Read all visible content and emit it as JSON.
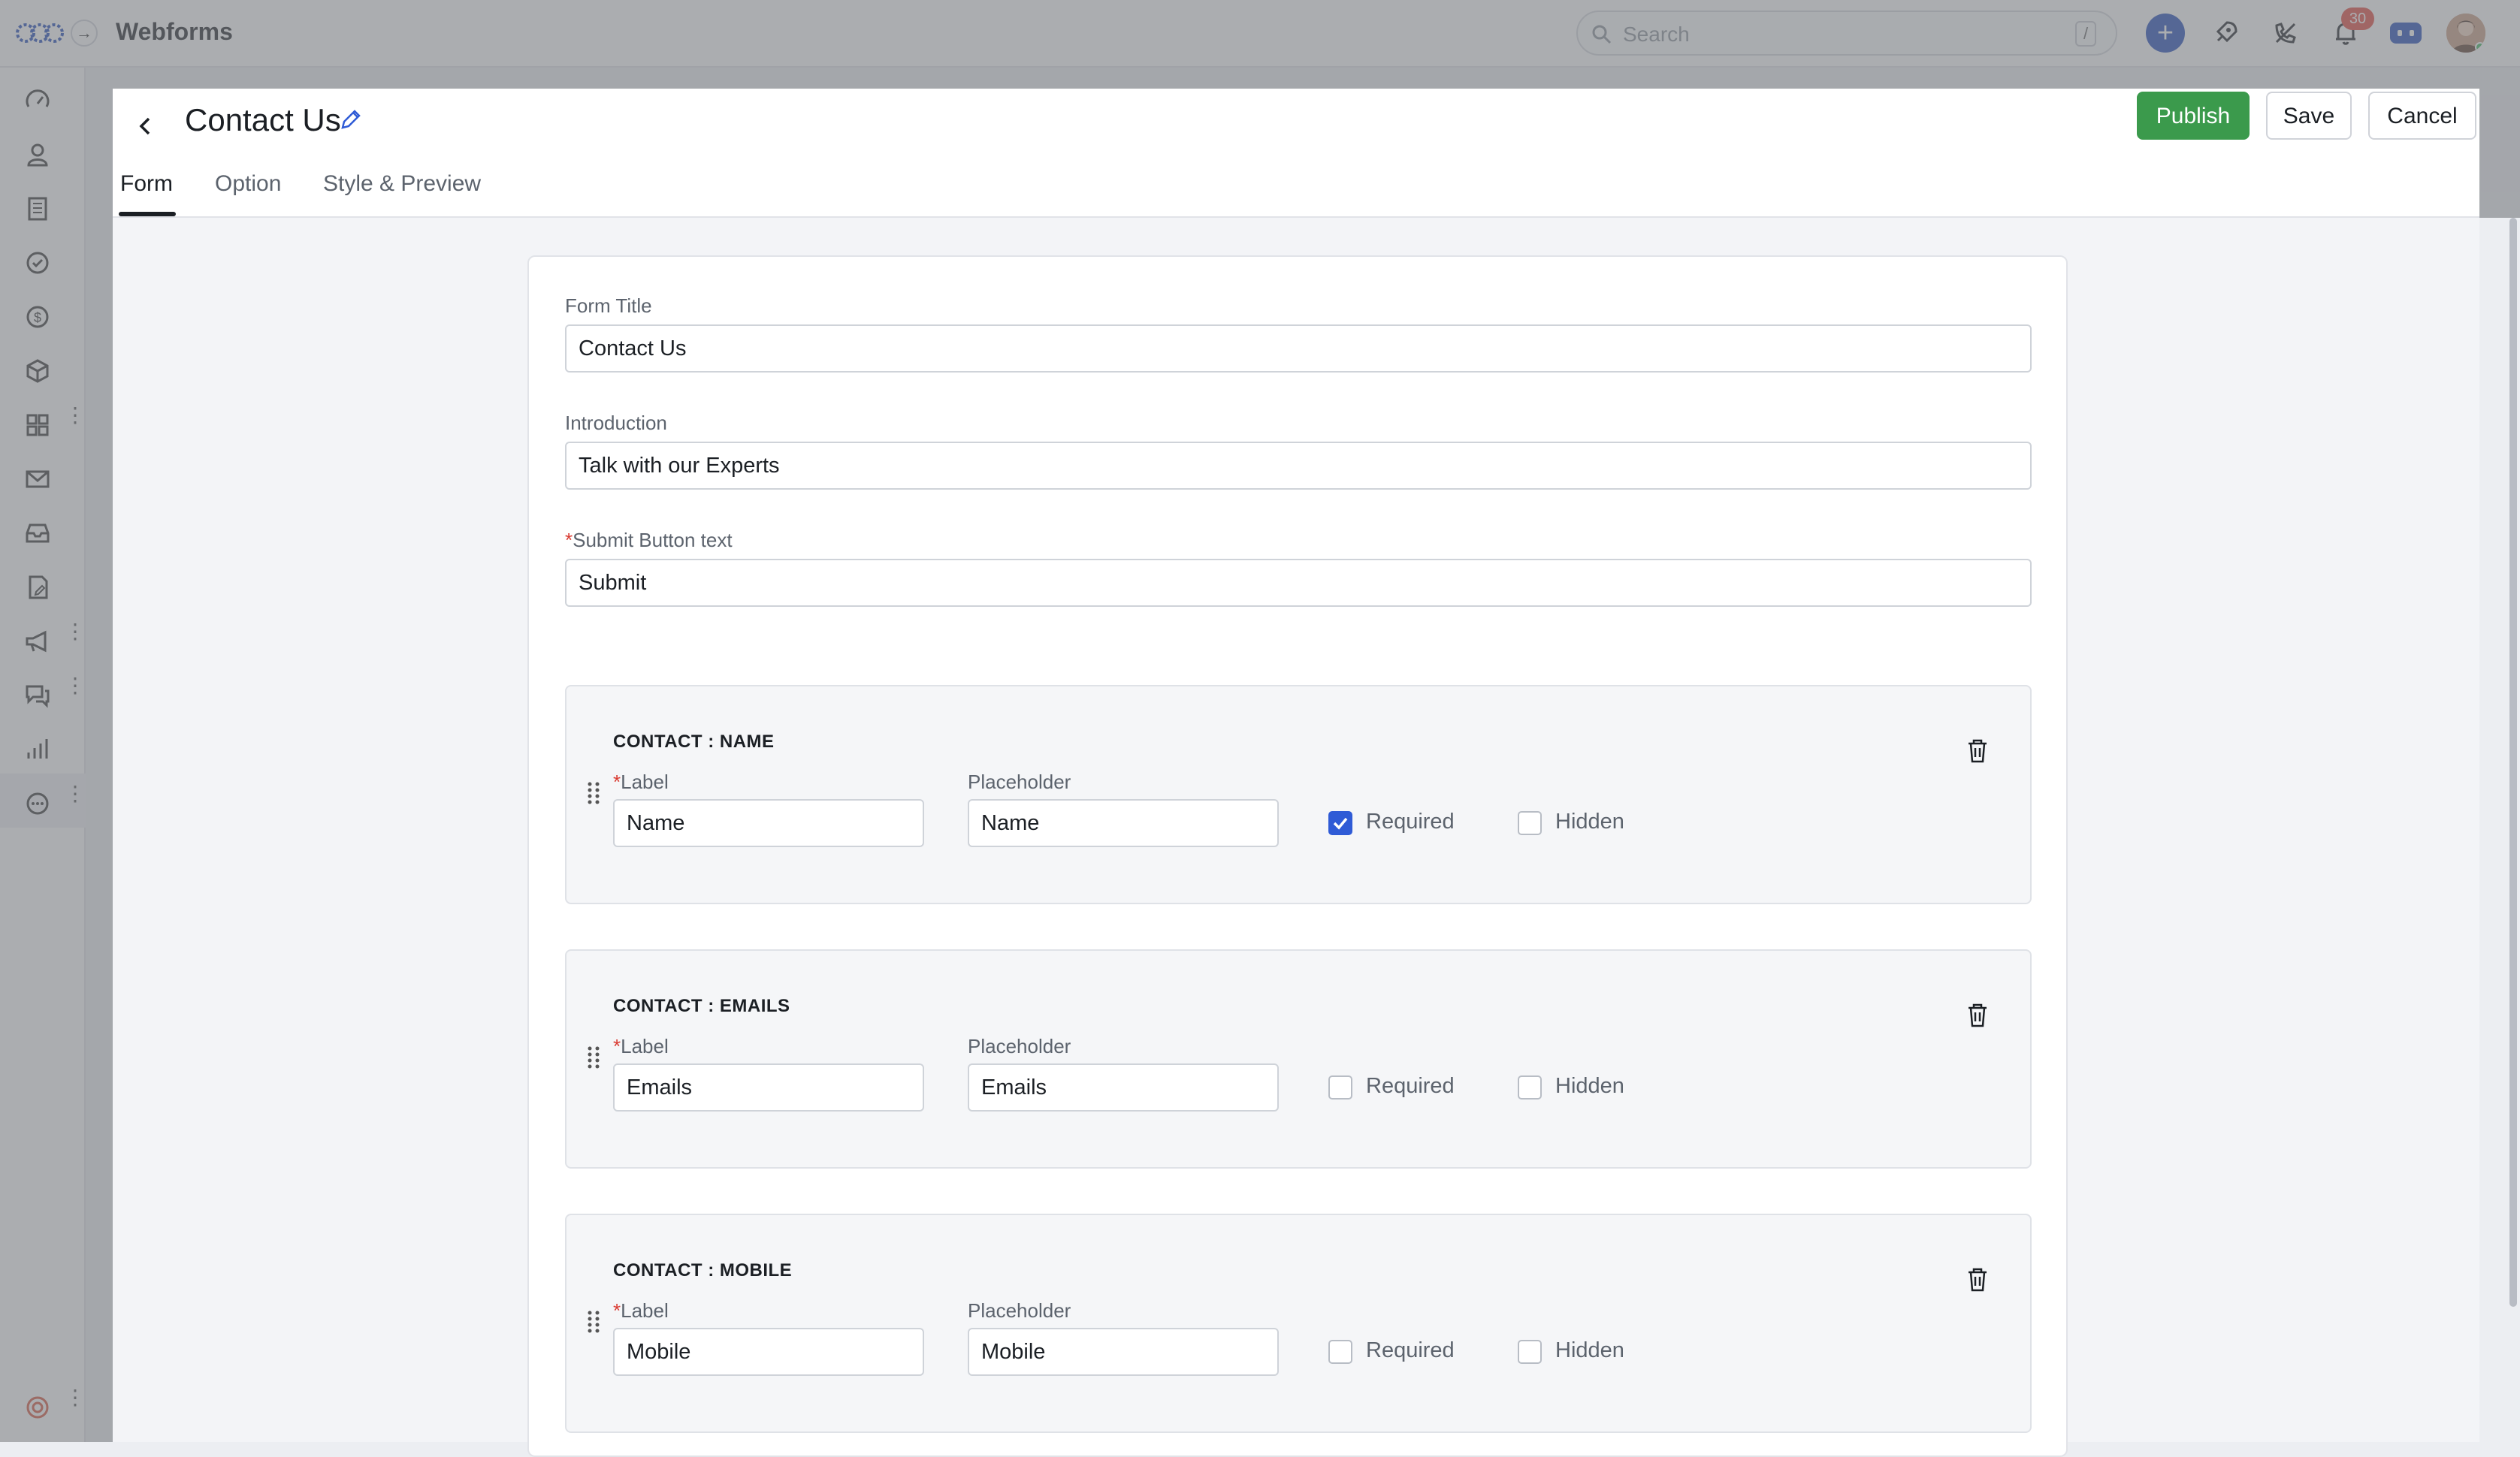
{
  "app": {
    "title": "Webforms"
  },
  "search": {
    "placeholder": "Search",
    "shortcut": "/"
  },
  "notifications": {
    "count": "30"
  },
  "page": {
    "title": "Contact Us"
  },
  "actions": {
    "publish": "Publish",
    "save": "Save",
    "cancel": "Cancel"
  },
  "tabs": [
    {
      "label": "Form",
      "active": true
    },
    {
      "label": "Option",
      "active": false
    },
    {
      "label": "Style & Preview",
      "active": false
    }
  ],
  "form": {
    "title_label": "Form Title",
    "title_value": "Contact Us",
    "intro_label": "Introduction",
    "intro_value": "Talk with our Experts",
    "submit_required_mark": "*",
    "submit_label": "Submit Button text",
    "submit_value": "Submit"
  },
  "fields": [
    {
      "title": "CONTACT : NAME",
      "label_caption": "Label",
      "label_value": "Name",
      "placeholder_caption": "Placeholder",
      "placeholder_value": "Name",
      "required_text": "Required",
      "required": true,
      "hidden_text": "Hidden",
      "hidden": false
    },
    {
      "title": "CONTACT : EMAILS",
      "label_caption": "Label",
      "label_value": "Emails",
      "placeholder_caption": "Placeholder",
      "placeholder_value": "Emails",
      "required_text": "Required",
      "required": false,
      "hidden_text": "Hidden",
      "hidden": false
    },
    {
      "title": "CONTACT : MOBILE",
      "label_caption": "Label",
      "label_value": "Mobile",
      "placeholder_caption": "Placeholder",
      "placeholder_value": "Mobile",
      "required_text": "Required",
      "required": false,
      "hidden_text": "Hidden",
      "hidden": false
    }
  ],
  "nav_icons": [
    "dashboard-icon",
    "contacts-icon",
    "companies-icon",
    "tasks-icon",
    "deals-icon",
    "products-icon",
    "apps-icon",
    "mail-icon",
    "inbox-icon",
    "documents-icon",
    "campaigns-icon",
    "chat-icon",
    "reports-icon",
    "more-icon"
  ],
  "colors": {
    "accent": "#1d47b8",
    "publish": "#3b9a4c",
    "badge": "#e2453c",
    "checkbox": "#2f5bd6"
  }
}
